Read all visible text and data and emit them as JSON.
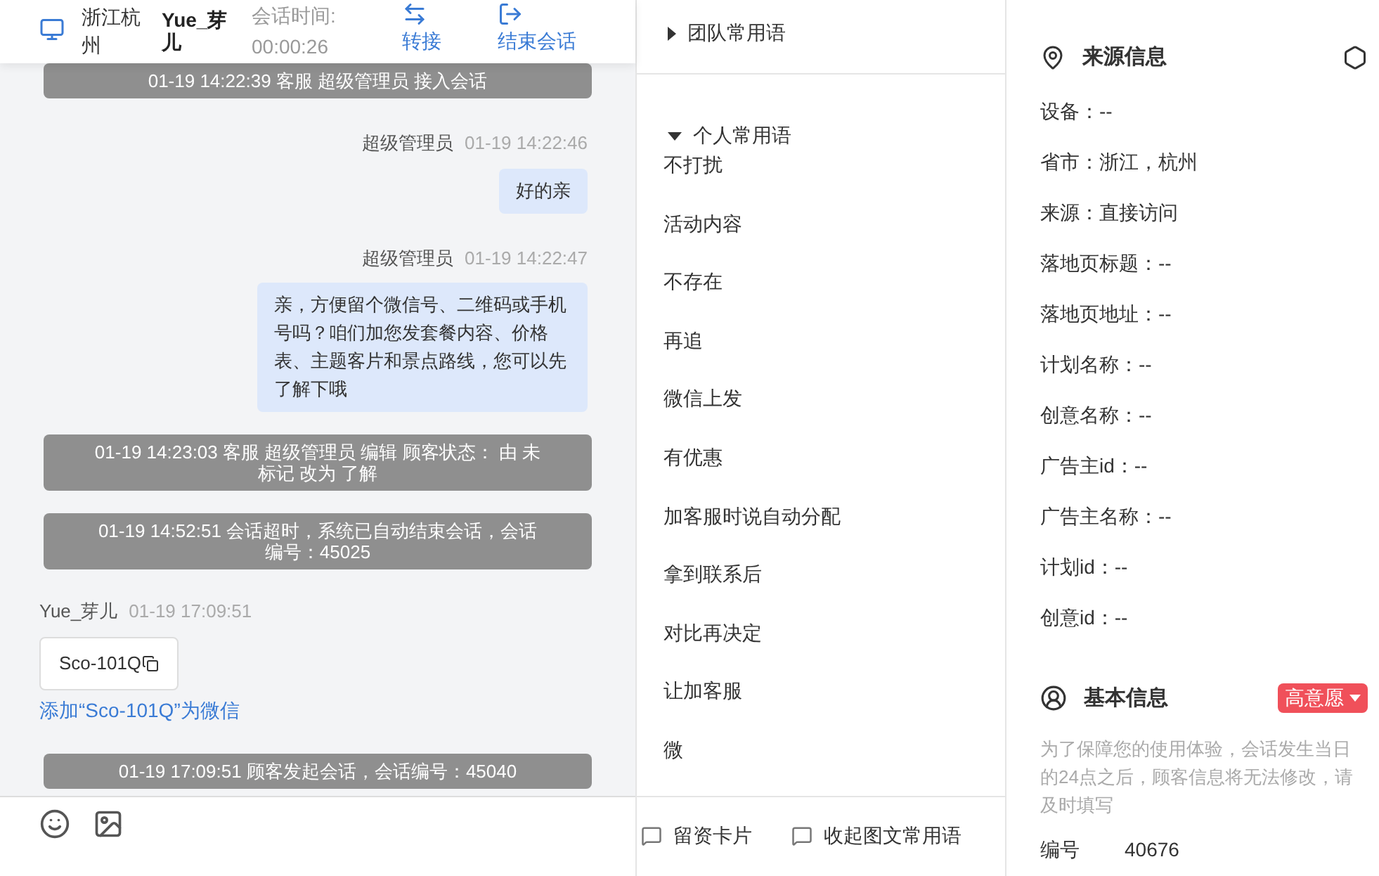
{
  "header": {
    "location": "浙江杭州",
    "customer": "Yue_芽儿",
    "duration_label": "会话时间:",
    "duration": "00:00:26",
    "actions": [
      {
        "kind": "transfer",
        "label": "转接"
      },
      {
        "kind": "end",
        "label": "结束会话"
      }
    ]
  },
  "messages": [
    {
      "kind": "system",
      "text": "01-19 14:22:39 客服 超级管理员 接入会话"
    },
    {
      "kind": "sent",
      "sender": "超级管理员",
      "time": "01-19 14:22:46",
      "text": "好的亲"
    },
    {
      "kind": "sent",
      "sender": "超级管理员",
      "time": "01-19 14:22:47",
      "text": "亲，方便留个微信号、二维码或手机号吗？咱们加您发套餐内容、价格表、主题客片和景点路线，您可以先了解下哦"
    },
    {
      "kind": "system",
      "text": "01-19 14:23:03 客服 超级管理员 编辑 顾客状态： 由 未标记 改为 了解"
    },
    {
      "kind": "system",
      "text": "01-19 14:52:51 会话超时，系统已自动结束会话，会话编号：45025"
    },
    {
      "kind": "received",
      "sender": "Yue_芽儿",
      "time": "01-19 17:09:51",
      "text": "Sco-101Q",
      "link": "添加“Sco-101Q”为微信"
    },
    {
      "kind": "system",
      "text": "01-19 17:09:51 顾客发起会话，会话编号：45040"
    }
  ],
  "phrases": {
    "groups": [
      {
        "title": "团队常用语",
        "expanded": false
      },
      {
        "title": "个人常用语",
        "expanded": true,
        "items": [
          "不打扰",
          "活动内容",
          "不存在",
          "再追",
          "微信上发",
          "有优惠",
          "加客服时说自动分配",
          "拿到联系后",
          "对比再决定",
          "让加客服",
          "微"
        ]
      }
    ],
    "toolbar": [
      "留资卡片",
      "收起图文常用语"
    ]
  },
  "source_info": {
    "title": "来源信息",
    "fields": [
      "设备：--",
      "省市：浙江，杭州",
      "来源：直接访问",
      "落地页标题：--",
      "落地页地址：--",
      "计划名称：--",
      "创意名称：--",
      "广告主id：--",
      "广告主名称：--",
      "计划id：--",
      "创意id：--"
    ]
  },
  "basic_info": {
    "title": "基本信息",
    "intent": "高意愿",
    "notice": "为了保障您的使用体验，会话发生当日的24点之后，顾客信息将无法修改，请及时填写",
    "fields": [
      {
        "label": "编号",
        "value": "40676"
      }
    ]
  }
}
